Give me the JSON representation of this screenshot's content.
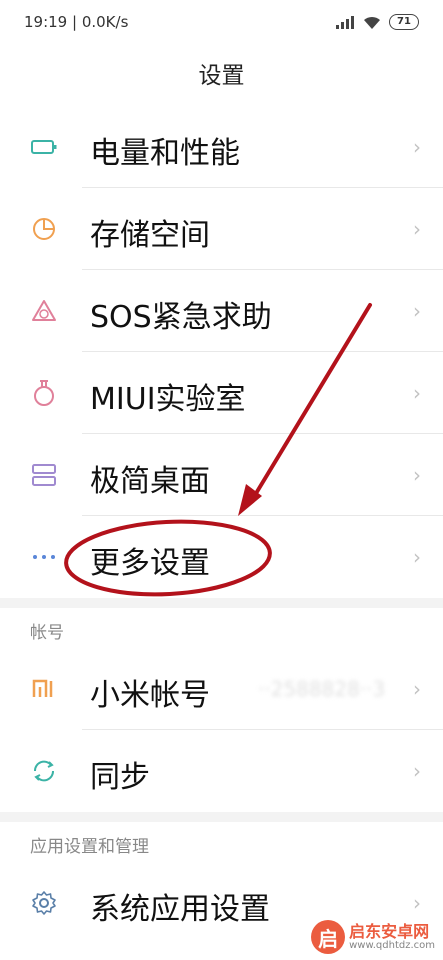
{
  "status_bar": {
    "time_net": "19:19 | 0.0K/s",
    "battery": "71"
  },
  "page_title": "设置",
  "items_main": [
    {
      "label": "电量和性能",
      "icon": "battery-icon"
    },
    {
      "label": "存储空间",
      "icon": "pie-chart-icon"
    },
    {
      "label": "SOS紧急求助",
      "icon": "sos-icon"
    },
    {
      "label": "MIUI实验室",
      "icon": "flask-icon"
    },
    {
      "label": "极简桌面",
      "icon": "simple-desktop-icon"
    },
    {
      "label": "更多设置",
      "icon": "more-dots-icon"
    }
  ],
  "section_account": "帐号",
  "items_account": [
    {
      "label": "小米帐号",
      "icon": "mi-logo-icon",
      "value": "··2588828··3"
    },
    {
      "label": "同步",
      "icon": "sync-icon"
    }
  ],
  "section_apps": "应用设置和管理",
  "items_apps": [
    {
      "label": "系统应用设置",
      "icon": "gear-icon"
    }
  ],
  "chevron": "›",
  "watermark": {
    "title": "启东安卓网",
    "url": "www.qdhtdz.com",
    "logo_char": "启"
  },
  "colors": {
    "icon_teal": "#3bb3a6",
    "icon_orange": "#f0a050",
    "icon_pink": "#e0809a",
    "icon_purple": "#a08ad0",
    "annotation_red": "#b3121b"
  }
}
